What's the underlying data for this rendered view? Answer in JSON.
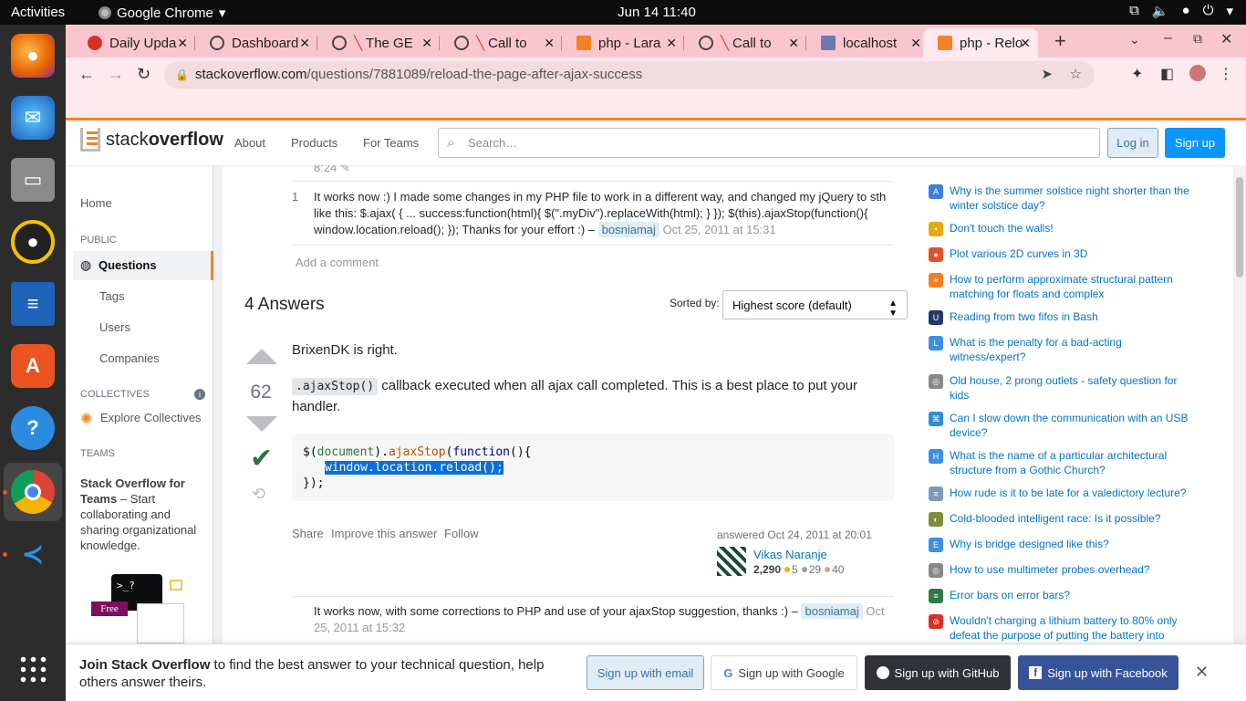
{
  "system": {
    "activities": "Activities",
    "app_name": "Google Chrome",
    "clock": "Jun 14  11:40"
  },
  "tabs": [
    {
      "label": "Daily Upda",
      "color": "#d93025"
    },
    {
      "label": "Dashboard",
      "color": "#555"
    },
    {
      "label": "The GE",
      "color": "#e53935"
    },
    {
      "label": "Call to",
      "color": "#e53935"
    },
    {
      "label": "php - Lara",
      "color": "#f48225"
    },
    {
      "label": "Call to",
      "color": "#e53935"
    },
    {
      "label": "localhost",
      "color": "#6c78af"
    },
    {
      "label": "php - Relo",
      "color": "#f48225"
    }
  ],
  "omnibox": {
    "host": "stackoverflow.com",
    "path": "/questions/7881089/reload-the-page-after-ajax-success"
  },
  "so_header": {
    "logo_a": "stack",
    "logo_b": "overflow",
    "about": "About",
    "products": "Products",
    "for_teams": "For Teams",
    "search_placeholder": "Search…",
    "login": "Log in",
    "signup": "Sign up"
  },
  "leftnav": {
    "home": "Home",
    "public": "PUBLIC",
    "questions": "Questions",
    "tags": "Tags",
    "users": "Users",
    "companies": "Companies",
    "collectives": "COLLECTIVES",
    "explore_collectives": "Explore Collectives",
    "teams": "TEAMS",
    "teams_title": "Stack Overflow for Teams",
    "teams_desc": " – Start collaborating and sharing organizational knowledge.",
    "free_badge": "Free"
  },
  "comments_top": {
    "partial_time": "8:24",
    "score": "1",
    "text": "It works now :) I made some changes in my PHP file to work in a different way, and changed my jQuery to sth like this: $.ajax( { ... success:function(html){ $(\".myDiv\").replaceWith(html); } }); $(this).ajaxStop(function(){ window.location.reload(); }); Thanks for your effort :) – ",
    "user": "bosniamaj",
    "date": "Oct 25, 2011 at 15:31",
    "add_comment": "Add a comment"
  },
  "answers": {
    "heading": "4 Answers",
    "sorted_by": "Sorted by:",
    "sort_value": "Highest score (default)"
  },
  "answer": {
    "score": "62",
    "para1": "BrixenDK is right.",
    "inline_code": ".ajaxStop()",
    "para2": " callback executed when all ajax call completed. This is a best place to put your handler.",
    "code_l1a": "$(",
    "code_l1b": "document",
    "code_l1c": ").",
    "code_l1d": "ajaxStop",
    "code_l1e": "(",
    "code_l1f": "function",
    "code_l1g": "(){",
    "code_l2": " window.location.reload();",
    "code_l3": "});",
    "share": "Share",
    "improve": "Improve this answer",
    "follow": "Follow",
    "answered": "answered Oct 24, 2011 at 20:01",
    "author": "Vikas Naranje",
    "rep": "2,290",
    "gold": "5",
    "silver": "29",
    "bronze": "40",
    "comment_text": "It works now, with some corrections to PHP and use of your ajaxStop suggestion, thanks :) – ",
    "comment_user": "bosniamaj",
    "comment_date_a": "Oct",
    "comment_date_b": "25, 2011 at 15:32"
  },
  "hot_questions": [
    {
      "icon": "A",
      "color": "#3d7ee0",
      "text": "Why is the summer solstice night shorter than the winter solstice day?"
    },
    {
      "icon": "•",
      "color": "#e6a817",
      "text": "Don't touch the walls!"
    },
    {
      "icon": "●",
      "color": "#e0542b",
      "text": "Plot various 2D curves in 3D"
    },
    {
      "icon": "≈",
      "color": "#f48225",
      "text": "How to perform approximate structural pattern matching for floats and complex"
    },
    {
      "icon": "U",
      "color": "#223a66",
      "text": "Reading from two fifos in Bash"
    },
    {
      "icon": "L",
      "color": "#3d8fe0",
      "text": "What is the penalty for a bad-acting witness/expert?"
    },
    {
      "icon": "◎",
      "color": "#888",
      "text": "Old house, 2 prong outlets - safety question for kids"
    },
    {
      "icon": "⌘",
      "color": "#2b8fd6",
      "text": "Can I slow down the communication with an USB device?"
    },
    {
      "icon": "H",
      "color": "#3d8fe0",
      "text": "What is the name of a particular architectural structure from a Gothic Church?"
    },
    {
      "icon": "≡",
      "color": "#7a9bb8",
      "text": "How rude is it to be late for a valedictory lecture?"
    },
    {
      "icon": "◐",
      "color": "#7c8f3b",
      "text": "Cold-blooded intelligent race: Is it possible?"
    },
    {
      "icon": "E",
      "color": "#3d8fe0",
      "text": "Why is bridge designed like this?"
    },
    {
      "icon": "◎",
      "color": "#888",
      "text": "How to use multimeter probes overhead?"
    },
    {
      "icon": "≡",
      "color": "#2f7a4a",
      "text": "Error bars on error bars?"
    },
    {
      "icon": "⊘",
      "color": "#d93025",
      "text": "Wouldn't charging a lithium battery to 80% only defeat the purpose of putting the battery into"
    }
  ],
  "join": {
    "bold": "Join Stack Overflow",
    "rest": " to find the best answer to your technical question, help others answer theirs.",
    "email": "Sign up with email",
    "google": "Sign up with Google",
    "github": "Sign up with GitHub",
    "facebook": "Sign up with Facebook"
  },
  "colors": {
    "so_orange": "#f48225",
    "so_blue": "#0a95ff",
    "tab_strip": "#f9c6cf",
    "accepted_green": "#2f6f44"
  }
}
